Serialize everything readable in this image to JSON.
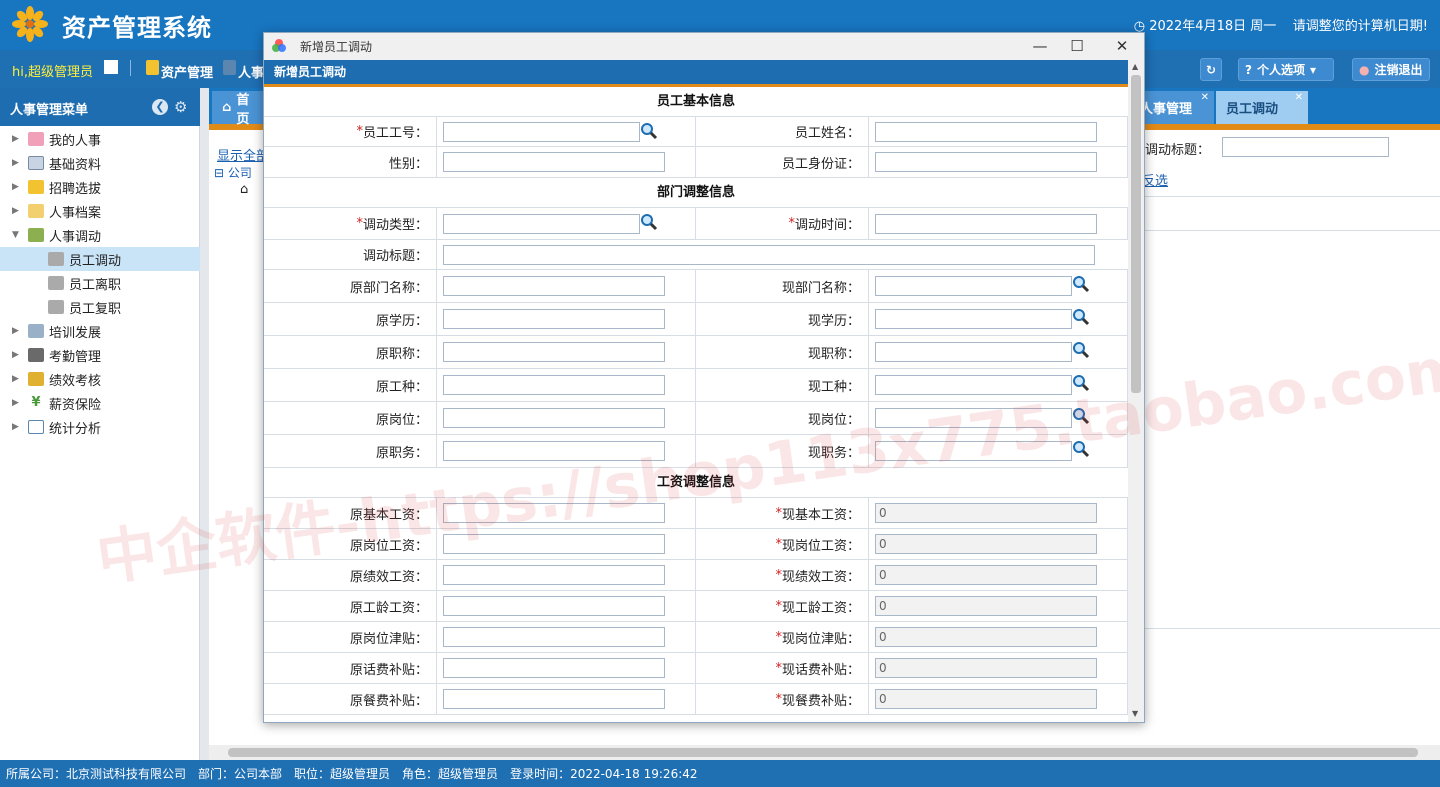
{
  "app": {
    "title": "资产管理系统",
    "date_text": "2022年4月18日 周一",
    "date_hint": "请调整您的计算机日期!"
  },
  "menubar": {
    "greeting": "hi,超级管理员",
    "modules": [
      "资产管理",
      "人事"
    ],
    "personal": "个人选项",
    "logout": "注销退出"
  },
  "sidebar": {
    "title": "人事管理菜单",
    "items": [
      {
        "label": "我的人事"
      },
      {
        "label": "基础资料"
      },
      {
        "label": "招聘选拔"
      },
      {
        "label": "人事档案"
      },
      {
        "label": "人事调动"
      },
      {
        "label": "员工调动"
      },
      {
        "label": "员工离职"
      },
      {
        "label": "员工复职"
      },
      {
        "label": "培训发展"
      },
      {
        "label": "考勤管理"
      },
      {
        "label": "绩效考核"
      },
      {
        "label": "薪资保险"
      },
      {
        "label": "统计分析"
      }
    ]
  },
  "tabs": {
    "home": "首页",
    "hr": "人事管理",
    "transfer": "员工调动"
  },
  "bg": {
    "show_all": "显示全部",
    "company": "公司",
    "title_label": "调动标题：",
    "reverse": "反选"
  },
  "dialog": {
    "window_title": "新增员工调动",
    "header": "新增员工调动",
    "sec1": "员工基本信息",
    "emp_no": "员工工号：",
    "emp_name": "员工姓名：",
    "gender": "性别：",
    "id_card": "员工身份证：",
    "sec2": "部门调整信息",
    "type": "调动类型：",
    "time": "调动时间：",
    "title": "调动标题：",
    "rows2": [
      {
        "l": "原部门名称：",
        "r": "现部门名称："
      },
      {
        "l": "原学历：",
        "r": "现学历："
      },
      {
        "l": "原职称：",
        "r": "现职称："
      },
      {
        "l": "原工种：",
        "r": "现工种："
      },
      {
        "l": "原岗位：",
        "r": "现岗位："
      },
      {
        "l": "原职务：",
        "r": "现职务："
      }
    ],
    "sec3": "工资调整信息",
    "rows3": [
      {
        "l": "原基本工资：",
        "r": "现基本工资：",
        "v": "0"
      },
      {
        "l": "原岗位工资：",
        "r": "现岗位工资：",
        "v": "0"
      },
      {
        "l": "原绩效工资：",
        "r": "现绩效工资：",
        "v": "0"
      },
      {
        "l": "原工龄工资：",
        "r": "现工龄工资：",
        "v": "0"
      },
      {
        "l": "原岗位津贴：",
        "r": "现岗位津贴：",
        "v": "0"
      },
      {
        "l": "原话费补贴：",
        "r": "现话费补贴：",
        "v": "0"
      },
      {
        "l": "原餐费补贴：",
        "r": "现餐费补贴：",
        "v": "0"
      }
    ]
  },
  "status": {
    "company": "所属公司：北京测试科技有限公司",
    "dept": "部门：公司本部",
    "post": "职位：超级管理员",
    "role": "角色：超级管理员",
    "login": "登录时间：2022-04-18 19:26:42"
  },
  "watermark": "中企软件-https://shop113x775.taobao.com",
  "colors": {
    "primary": "#1875c0",
    "accent": "#e08a18",
    "required": "#d02020"
  }
}
